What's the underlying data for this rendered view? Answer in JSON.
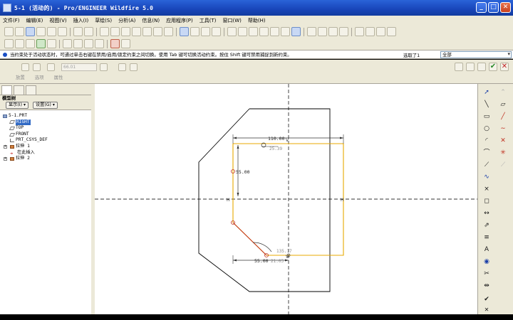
{
  "window": {
    "title": "5-1 (活动的) - Pro/ENGINEER Wildfire 5.0",
    "minimize": "_",
    "maximize": "□",
    "close": "✕"
  },
  "menu": [
    "文件(F)",
    "编辑(E)",
    "视图(V)",
    "插入(I)",
    "草绘(S)",
    "分析(A)",
    "信息(N)",
    "应用程序(P)",
    "工具(T)",
    "窗口(W)",
    "帮助(H)"
  ],
  "message": {
    "text": "当约束处于活动状态时，可通过单击右键在禁用/启用/锁定约束之间切换。使用 Tab 键可切换活动约束。按住 Shift 键可禁用捕捉到新约束。",
    "filter_label": "选取了1",
    "filter_value": "全部"
  },
  "dashboard": {
    "depth_value": "66.01",
    "tabs": [
      "放置",
      "选项",
      "属性"
    ]
  },
  "model_tree": {
    "header": "模型树",
    "show_button": "显示(I)",
    "settings_button": "设置(G)",
    "items": [
      {
        "label": "5-1.PRT",
        "icon": "part-icon"
      },
      {
        "label": "RIGHT",
        "icon": "datum-plane-icon",
        "selected": true
      },
      {
        "label": "TOP",
        "icon": "datum-plane-icon"
      },
      {
        "label": "FRONT",
        "icon": "datum-plane-icon"
      },
      {
        "label": "PRT_CSYS_DEF",
        "icon": "csys-icon"
      },
      {
        "label": "拉伸 1",
        "icon": "extrude-icon",
        "expandable": true
      },
      {
        "label": "在此插入",
        "icon": "insert-here-icon"
      },
      {
        "label": "拉伸 2",
        "icon": "extrude-icon",
        "expandable": true
      }
    ]
  },
  "sketch": {
    "dimensions": {
      "top_width": "110.00",
      "top_angle": "25.39",
      "left_height": "55.00",
      "bottom_width": "55.00",
      "bottom_offset": "21.03",
      "arc_angle": "135.17"
    },
    "axis_labels": {
      "h_left": "H",
      "h_right": "H",
      "v_top": "V",
      "v_bottom": "V"
    }
  },
  "colors": {
    "sketch_line": "#e8a800",
    "geometry": "#000000",
    "dimension": "#3a3a3a",
    "constraint": "#c03020"
  }
}
